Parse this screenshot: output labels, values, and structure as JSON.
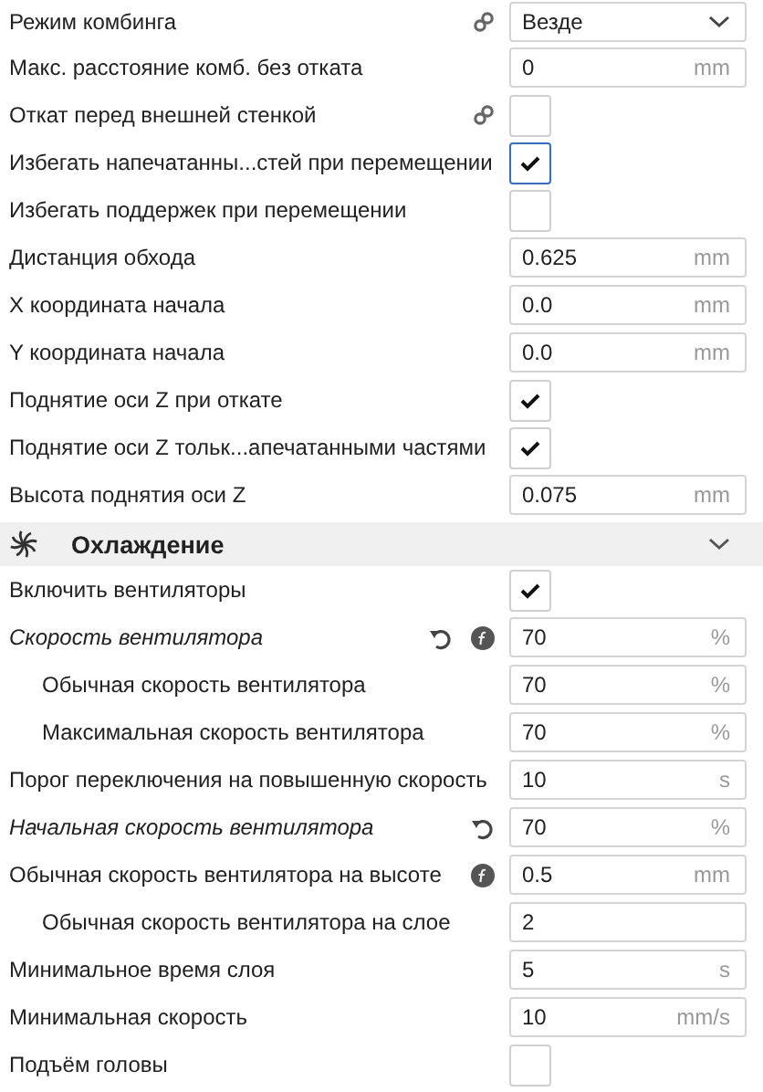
{
  "settings": [
    {
      "kind": "dropdown",
      "label": "Режим комбинга",
      "linked": true,
      "value": "Везде"
    },
    {
      "kind": "number",
      "label": "Макс. расстояние комб. без отката",
      "value": "0",
      "unit": "mm"
    },
    {
      "kind": "checkbox",
      "label": "Откат перед внешней стенкой",
      "linked": true,
      "checked": false
    },
    {
      "kind": "checkbox",
      "label": "Избегать напечатанны...стей при перемещении",
      "checked": true,
      "focused": true
    },
    {
      "kind": "checkbox",
      "label": "Избегать поддержек при перемещении",
      "checked": false
    },
    {
      "kind": "number",
      "label": "Дистанция обхода",
      "value": "0.625",
      "unit": "mm"
    },
    {
      "kind": "number",
      "label": "X координата начала",
      "value": "0.0",
      "unit": "mm"
    },
    {
      "kind": "number",
      "label": "Y координата начала",
      "value": "0.0",
      "unit": "mm"
    },
    {
      "kind": "checkbox",
      "label": "Поднятие оси Z при откате",
      "checked": true
    },
    {
      "kind": "checkbox",
      "label": "Поднятие оси Z тольк...апечатанными частями",
      "checked": true
    },
    {
      "kind": "number",
      "label": "Высота поднятия оси Z",
      "value": "0.075",
      "unit": "mm"
    }
  ],
  "section": {
    "title": "Охлаждение",
    "expanded": true,
    "settings": [
      {
        "kind": "checkbox",
        "label": "Включить вентиляторы",
        "checked": true
      },
      {
        "kind": "number",
        "label": "Скорость вентилятора",
        "italic": true,
        "resettable": true,
        "has_function": true,
        "value": "70",
        "unit": "%",
        "children": [
          {
            "kind": "number",
            "label": "Обычная скорость вентилятора",
            "value": "70",
            "unit": "%"
          },
          {
            "kind": "number",
            "label": "Максимальная скорость вентилятора",
            "value": "70",
            "unit": "%"
          }
        ]
      },
      {
        "kind": "number",
        "label": "Порог переключения на повышенную скорость",
        "value": "10",
        "unit": "s"
      },
      {
        "kind": "number",
        "label": "Начальная скорость вентилятора",
        "italic": true,
        "resettable": true,
        "value": "70",
        "unit": "%"
      },
      {
        "kind": "number",
        "label": "Обычная скорость вентилятора на высоте",
        "has_function": true,
        "value": "0.5",
        "unit": "mm",
        "children": [
          {
            "kind": "number",
            "label": "Обычная скорость вентилятора на слое",
            "value": "2"
          }
        ]
      },
      {
        "kind": "number",
        "label": "Минимальное время слоя",
        "value": "5",
        "unit": "s"
      },
      {
        "kind": "number",
        "label": "Минимальная скорость",
        "value": "10",
        "unit": "mm/s"
      },
      {
        "kind": "checkbox",
        "label": "Подъём головы",
        "checked": false
      }
    ]
  }
}
